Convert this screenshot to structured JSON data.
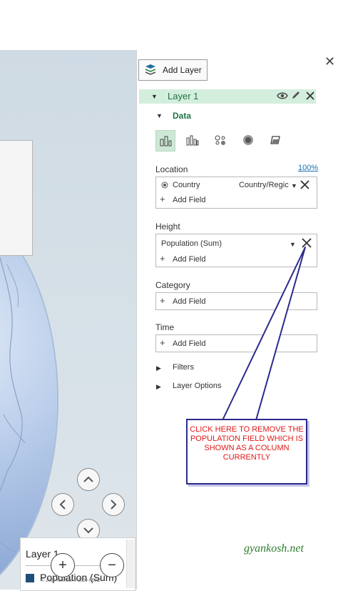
{
  "pane": {
    "add_layer_label": "Add Layer",
    "layer_name": "Layer 1",
    "data_header": "Data",
    "location": {
      "label": "Location",
      "percent": "100%",
      "field_name": "Country",
      "field_type": "Country/Regic",
      "add_field": "Add Field"
    },
    "height": {
      "label": "Height",
      "field_name": "Population (Sum)",
      "add_field": "Add Field"
    },
    "category": {
      "label": "Category",
      "add_field": "Add Field"
    },
    "time": {
      "label": "Time",
      "add_field": "Add Field"
    },
    "filters_label": "Filters",
    "layer_options_label": "Layer Options"
  },
  "legend": {
    "title": "Layer 1",
    "series": "Population (Sum)",
    "swatch_color": "#1f4e79"
  },
  "map": {
    "copyright": "© 2020 TomTom © 2020 HERE"
  },
  "callout": {
    "text": "CLICK HERE TO REMOVE THE POPULATION FIELD WHICH IS SHOWN AS A COLUMN CURRENTLY"
  },
  "watermark": "gyankosh.net",
  "icons": {
    "close": "close-icon",
    "eye": "eye-icon",
    "pencil": "pencil-icon",
    "remove": "remove-x-icon"
  },
  "colors": {
    "accent_green": "#217346",
    "layer_bar": "#d4eedd",
    "callout_border": "#2b2a8c",
    "callout_text": "#e01818"
  }
}
